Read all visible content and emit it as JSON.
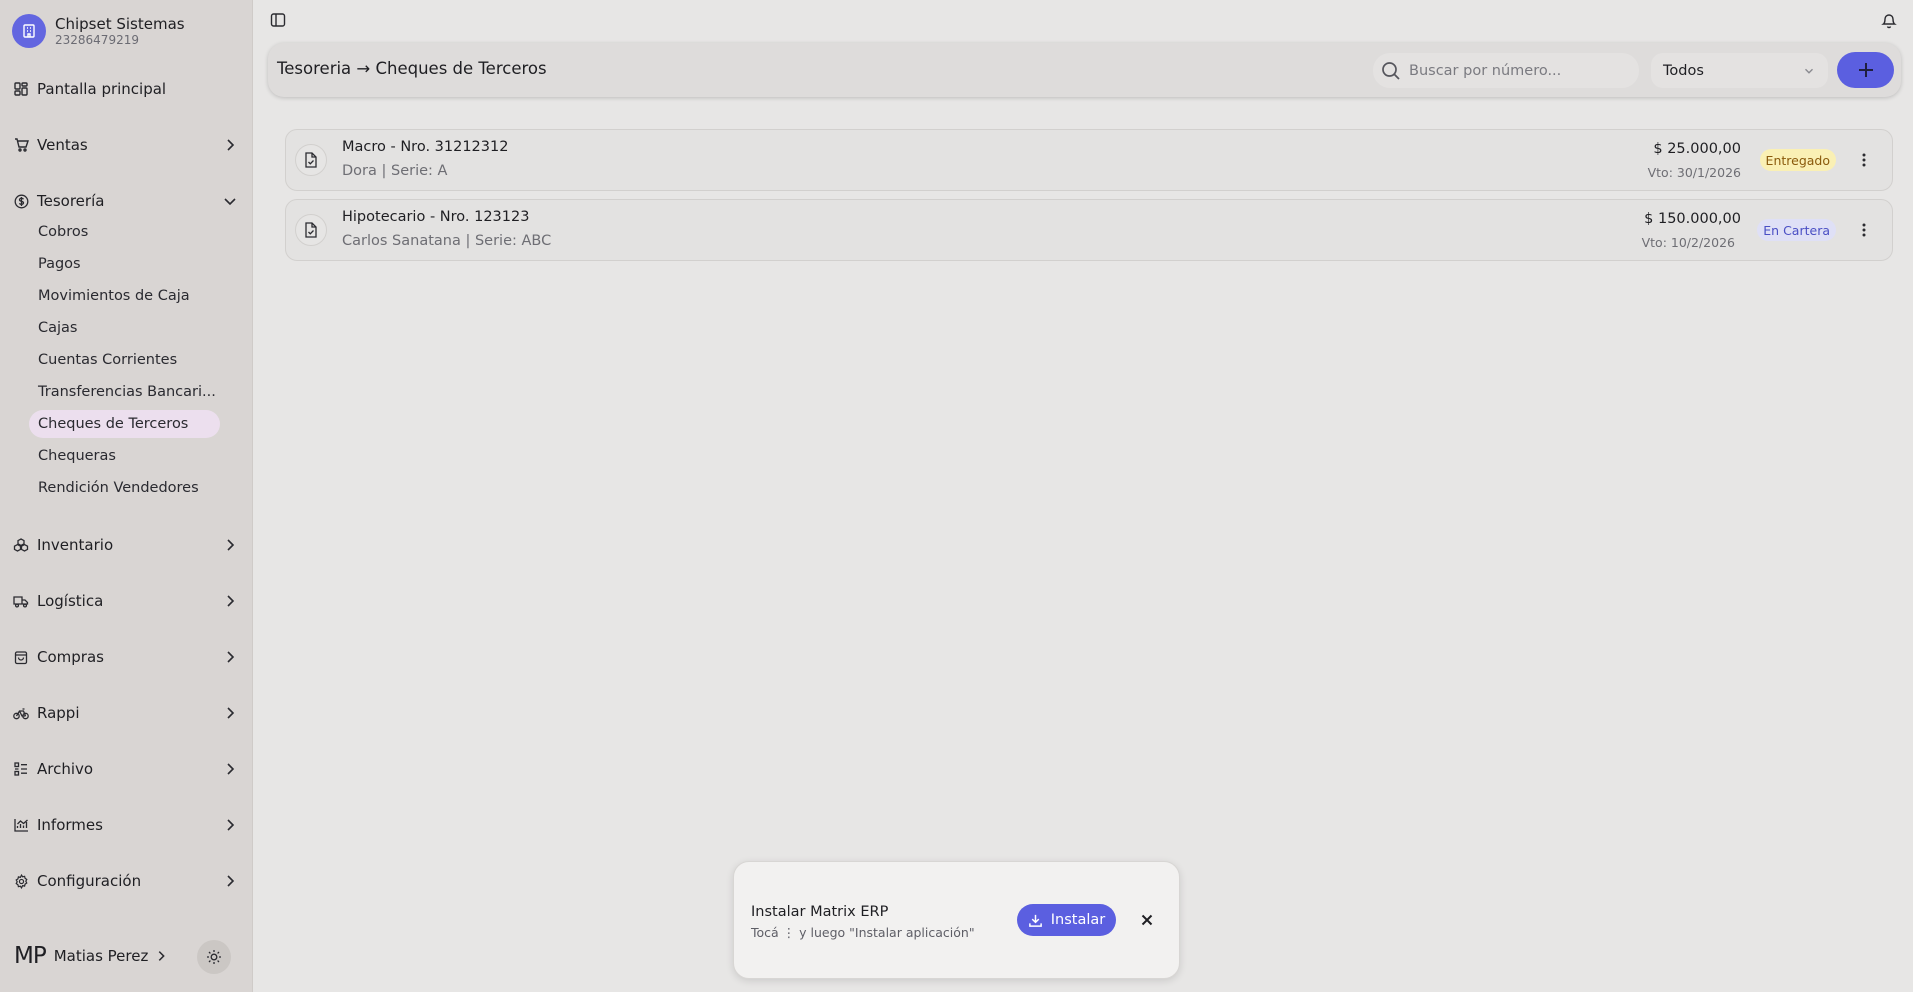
{
  "company": {
    "name": "Chipset Sistemas",
    "id": "23286479219"
  },
  "sidebar": {
    "items": [
      {
        "label": "Pantalla principal",
        "icon": "dashboard-icon"
      },
      {
        "label": "Ventas",
        "icon": "cart-icon"
      },
      {
        "label": "Tesorería",
        "icon": "dollar-circle-icon"
      },
      {
        "label": "Inventario",
        "icon": "boxes-icon"
      },
      {
        "label": "Logística",
        "icon": "truck-icon"
      },
      {
        "label": "Compras",
        "icon": "shopping-bag-icon"
      },
      {
        "label": "Rappi",
        "icon": "bike-icon"
      },
      {
        "label": "Archivo",
        "icon": "list-icon"
      },
      {
        "label": "Informes",
        "icon": "chart-icon"
      },
      {
        "label": "Configuración",
        "icon": "gear-icon"
      }
    ],
    "tesoreria_sub": [
      "Cobros",
      "Pagos",
      "Movimientos de Caja",
      "Cajas",
      "Cuentas Corrientes",
      "Transferencias Bancari...",
      "Cheques de Terceros",
      "Chequeras",
      "Rendición Vendedores"
    ],
    "active_sub": "Cheques de Terceros"
  },
  "user": {
    "initials": "MP",
    "name": "Matias Perez"
  },
  "header": {
    "breadcrumb": "Tesoreria → Cheques de Terceros",
    "search_placeholder": "Buscar por número...",
    "filter_value": "Todos"
  },
  "cheques": [
    {
      "title": "Macro - Nro. 31212312",
      "subtitle": "Dora | Serie: A",
      "amount": "$  25.000,00",
      "vto": "Vto: 30/1/2026",
      "status": "Entregado"
    },
    {
      "title": "Hipotecario - Nro. 123123",
      "subtitle": "Carlos Sanatana | Serie: ABC",
      "amount": "$  150.000,00",
      "vto": "Vto: 10/2/2026",
      "status": "En Cartera"
    }
  ],
  "toast": {
    "title": "Instalar Matrix ERP",
    "text": "Tocá  ⋮ y luego \"Instalar aplicación\"",
    "button": "Instalar"
  },
  "colors": {
    "accent": "#5b5fe0",
    "sidebar_bg": "#d9d5d3",
    "page_bg": "#e7e6e5"
  }
}
